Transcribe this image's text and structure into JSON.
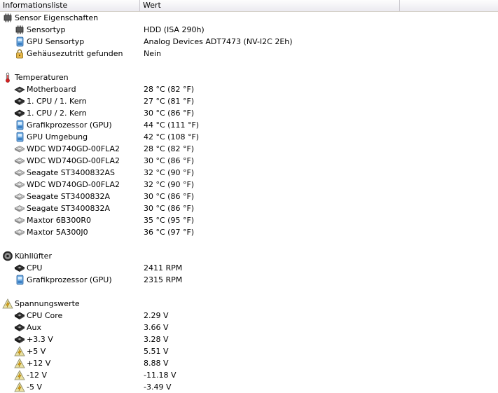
{
  "columns": [
    "Informationsliste",
    "Wert"
  ],
  "sections": [
    {
      "name": "sensor-properties",
      "title": "Sensor Eigenschaften",
      "icon": "chip-icon",
      "items": [
        {
          "label": "Sensortyp",
          "value": "HDD  (ISA 290h)",
          "icon": "chip-icon"
        },
        {
          "label": "GPU Sensortyp",
          "value": "Analog Devices ADT7473  (NV-I2C 2Eh)",
          "icon": "gpu-icon"
        },
        {
          "label": "Gehäusezutritt gefunden",
          "value": "Nein",
          "icon": "lock-icon"
        }
      ]
    },
    {
      "name": "temperatures",
      "title": "Temperaturen",
      "icon": "thermometer-icon",
      "items": [
        {
          "label": "Motherboard",
          "value": "28 °C  (82 °F)",
          "icon": "motherboard-icon"
        },
        {
          "label": "1. CPU / 1. Kern",
          "value": "27 °C  (81 °F)",
          "icon": "cpu-icon"
        },
        {
          "label": "1. CPU / 2. Kern",
          "value": "30 °C  (86 °F)",
          "icon": "cpu-icon"
        },
        {
          "label": "Grafikprozessor (GPU)",
          "value": "44 °C  (111 °F)",
          "icon": "gpu-icon"
        },
        {
          "label": "GPU Umgebung",
          "value": "42 °C  (108 °F)",
          "icon": "gpu-icon"
        },
        {
          "label": "WDC WD740GD-00FLA2",
          "value": "28 °C  (82 °F)",
          "icon": "hard-drive-icon"
        },
        {
          "label": "WDC WD740GD-00FLA2",
          "value": "30 °C  (86 °F)",
          "icon": "hard-drive-icon"
        },
        {
          "label": "Seagate ST3400832AS",
          "value": "32 °C  (90 °F)",
          "icon": "hard-drive-icon"
        },
        {
          "label": "WDC WD740GD-00FLA2",
          "value": "32 °C  (90 °F)",
          "icon": "hard-drive-icon"
        },
        {
          "label": "Seagate ST3400832A",
          "value": "30 °C  (86 °F)",
          "icon": "hard-drive-icon"
        },
        {
          "label": "Seagate ST3400832A",
          "value": "30 °C  (86 °F)",
          "icon": "hard-drive-icon"
        },
        {
          "label": "Maxtor 6B300R0",
          "value": "35 °C  (95 °F)",
          "icon": "hard-drive-icon"
        },
        {
          "label": "Maxtor 5A300J0",
          "value": "36 °C  (97 °F)",
          "icon": "hard-drive-icon"
        }
      ]
    },
    {
      "name": "cooling-fans",
      "title": "Kühllüfter",
      "icon": "fan-icon",
      "items": [
        {
          "label": "CPU",
          "value": "2411 RPM",
          "icon": "cpu-icon"
        },
        {
          "label": "Grafikprozessor (GPU)",
          "value": "2315 RPM",
          "icon": "gpu-icon"
        }
      ]
    },
    {
      "name": "voltages",
      "title": "Spannungswerte",
      "icon": "voltage-icon",
      "items": [
        {
          "label": "CPU Core",
          "value": "2.29 V",
          "icon": "cpu-icon"
        },
        {
          "label": "Aux",
          "value": "3.66 V",
          "icon": "cpu-icon"
        },
        {
          "label": "+3.3 V",
          "value": "3.28 V",
          "icon": "cpu-icon"
        },
        {
          "label": "+5 V",
          "value": "5.51 V",
          "icon": "voltage-icon"
        },
        {
          "label": "+12 V",
          "value": "8.88 V",
          "icon": "voltage-icon"
        },
        {
          "label": "-12 V",
          "value": "-11.18 V",
          "icon": "voltage-icon"
        },
        {
          "label": "-5 V",
          "value": "-3.49 V",
          "icon": "voltage-icon"
        }
      ]
    }
  ]
}
